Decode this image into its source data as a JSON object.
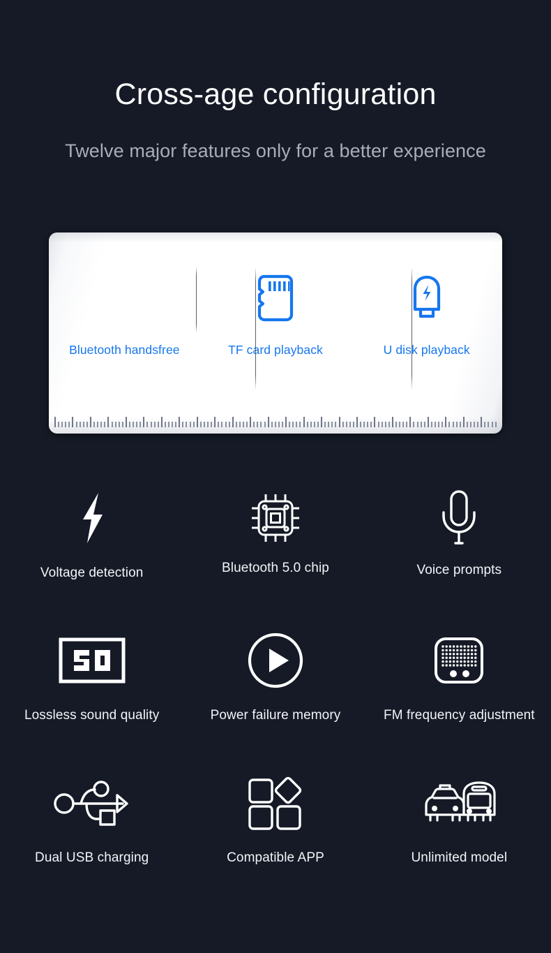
{
  "theme": {
    "background": "#151a26",
    "accent_blue": "#1677ee",
    "text_primary": "#ffffff",
    "text_secondary": "#a8adb8",
    "card_background": "#ffffff"
  },
  "header": {
    "title": "Cross-age configuration",
    "subtitle": "Twelve major features only for a better experience"
  },
  "card": {
    "cells": [
      {
        "label": "Bluetooth handsfree",
        "icon": "bluetooth-icon"
      },
      {
        "label": "TF card playback",
        "icon": "tf-card-icon"
      },
      {
        "label": "U disk playback",
        "icon": "usb-drive-icon"
      }
    ]
  },
  "features": {
    "rows": [
      [
        {
          "label": "Voltage detection",
          "icon": "lightning-bolt-icon"
        },
        {
          "label": "Bluetooth 5.0 chip",
          "icon": "chip-icon"
        },
        {
          "label": "Voice prompts",
          "icon": "microphone-icon"
        }
      ],
      [
        {
          "label": "Lossless sound quality",
          "icon": "fifty-badge-icon"
        },
        {
          "label": "Power failure memory",
          "icon": "play-circle-icon"
        },
        {
          "label": "FM frequency adjustment",
          "icon": "radio-icon"
        }
      ],
      [
        {
          "label": "Dual USB charging",
          "icon": "usb-trident-icon"
        },
        {
          "label": "Compatible APP",
          "icon": "apps-grid-icon"
        },
        {
          "label": "Unlimited model",
          "icon": "taxi-bus-icon"
        }
      ]
    ]
  }
}
